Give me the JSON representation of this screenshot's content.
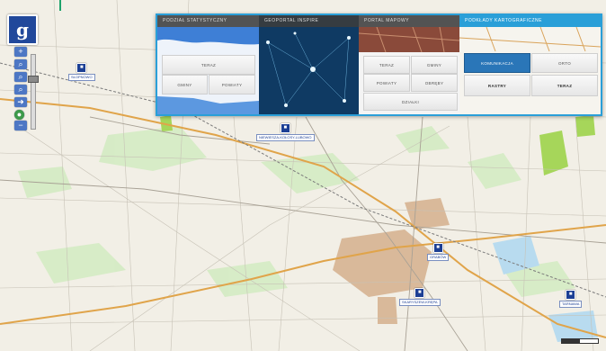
{
  "colors": {
    "accent": "#2a9fd8",
    "marker": "#1c3f94",
    "map_bg": "#f2efe6",
    "road_major": "#e0a44a",
    "forest": "#d4ebc3",
    "urban": "#d9b99a"
  },
  "toolbar": {
    "logo_glyph": "g",
    "zoom_in_glyph": "+",
    "zoom_out_glyph": "−",
    "tools": [
      "magnify-icon",
      "magnify-icon",
      "magnify-icon",
      "pan-arrow-icon",
      "globe-icon"
    ],
    "zoom_level_fraction": 0.3
  },
  "panel": {
    "tiles": [
      {
        "title": "PODZIAŁ STATYSTYCZNY",
        "buttons": [
          {
            "label": "TERAZ"
          },
          {
            "label": "GMINY"
          },
          {
            "label": "POWIATY"
          }
        ]
      },
      {
        "title": "GEOPORTAL INSPIRE"
      },
      {
        "title": "PORTAL MAPOWY",
        "buttons": [
          {
            "label": "TERAZ"
          },
          {
            "label": "GMINY"
          },
          {
            "label": "POWIATY"
          },
          {
            "label": "OBRĘBY"
          },
          {
            "label": "DZIAŁKI"
          }
        ]
      },
      {
        "title": "PODKŁADY KARTOGRAFICZNE",
        "buttons": [
          {
            "label": "KOMUNIKACJA"
          },
          {
            "label": "ORTO"
          },
          {
            "label": "RASTRY"
          },
          {
            "label": "TERAZ"
          }
        ]
      }
    ]
  },
  "markers": [
    {
      "label": "SŁOPNOWO"
    },
    {
      "label": "NIEWIESZA-KOŁOSY-LUBOWO"
    },
    {
      "label": "GRABÓW"
    },
    {
      "label": "SKARYSZEW-KRĘPA"
    },
    {
      "label": "TARNAWA"
    }
  ]
}
